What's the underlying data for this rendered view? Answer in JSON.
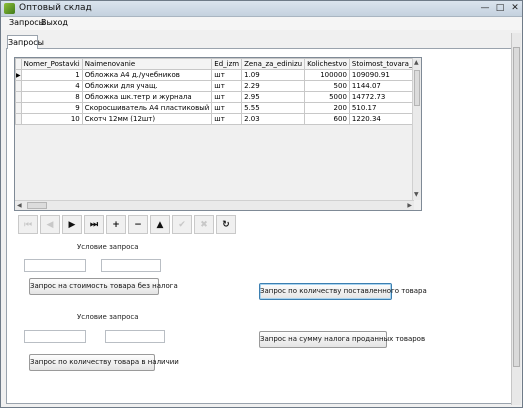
{
  "window": {
    "title": "Оптовый склад",
    "controls": {
      "minimize": "—",
      "maximize": "□",
      "close": "✕"
    }
  },
  "menu": [
    "Запросы",
    "Выход"
  ],
  "tabs": [
    "Запросы"
  ],
  "grid": {
    "columns": [
      "Nomer_Postavki",
      "Naimenovanie",
      "Ed_izm",
      "Zena_za_edinizu",
      "Kolichestvo",
      "Stoimost_tovara_bez_nal"
    ],
    "rows": [
      [
        "1",
        "Обложка А4 д./учебников",
        "шт",
        "1.09",
        "100000",
        "109090.91"
      ],
      [
        "4",
        "Обложки для учащ.",
        "шт",
        "2.29",
        "500",
        "1144.07"
      ],
      [
        "8",
        "Обложка шк.тетр и журнала",
        "шт",
        "2.95",
        "5000",
        "14772.73"
      ],
      [
        "9",
        "Скоросшиватель А4 пластиковый",
        "шт",
        "5.55",
        "200",
        "510.17"
      ],
      [
        "10",
        "Скотч 12мм (12шт)",
        "шт",
        "2.03",
        "600",
        "1220.34"
      ]
    ],
    "current_row_marker": "▶"
  },
  "navigator": [
    {
      "name": "nav-first-button",
      "glyph": "⏮",
      "enabled": false
    },
    {
      "name": "nav-prior-button",
      "glyph": "◀",
      "enabled": false
    },
    {
      "name": "nav-next-button",
      "glyph": "▶",
      "enabled": true
    },
    {
      "name": "nav-last-button",
      "glyph": "⏭",
      "enabled": true
    },
    {
      "name": "nav-insert-button",
      "glyph": "+",
      "enabled": true
    },
    {
      "name": "nav-delete-button",
      "glyph": "−",
      "enabled": true
    },
    {
      "name": "nav-edit-button",
      "glyph": "▲",
      "enabled": true
    },
    {
      "name": "nav-post-button",
      "glyph": "✔",
      "enabled": false
    },
    {
      "name": "nav-cancel-button",
      "glyph": "✖",
      "enabled": false
    },
    {
      "name": "nav-refresh-button",
      "glyph": "↻",
      "enabled": true
    }
  ],
  "query1": {
    "label": "Условие запроса",
    "input1_value": "",
    "input2_value": "",
    "button": "Запрос на стоимость товара без налога"
  },
  "query2": {
    "label": "Условие запроса",
    "input1_value": "",
    "input2_value": "",
    "button": "Запрос по количеству товара в наличии"
  },
  "buttons": {
    "supplied_quantity": "Запрос по количеству поставленного товара",
    "sales_tax_sum": "Запрос на сумму налога проданных товаров"
  }
}
